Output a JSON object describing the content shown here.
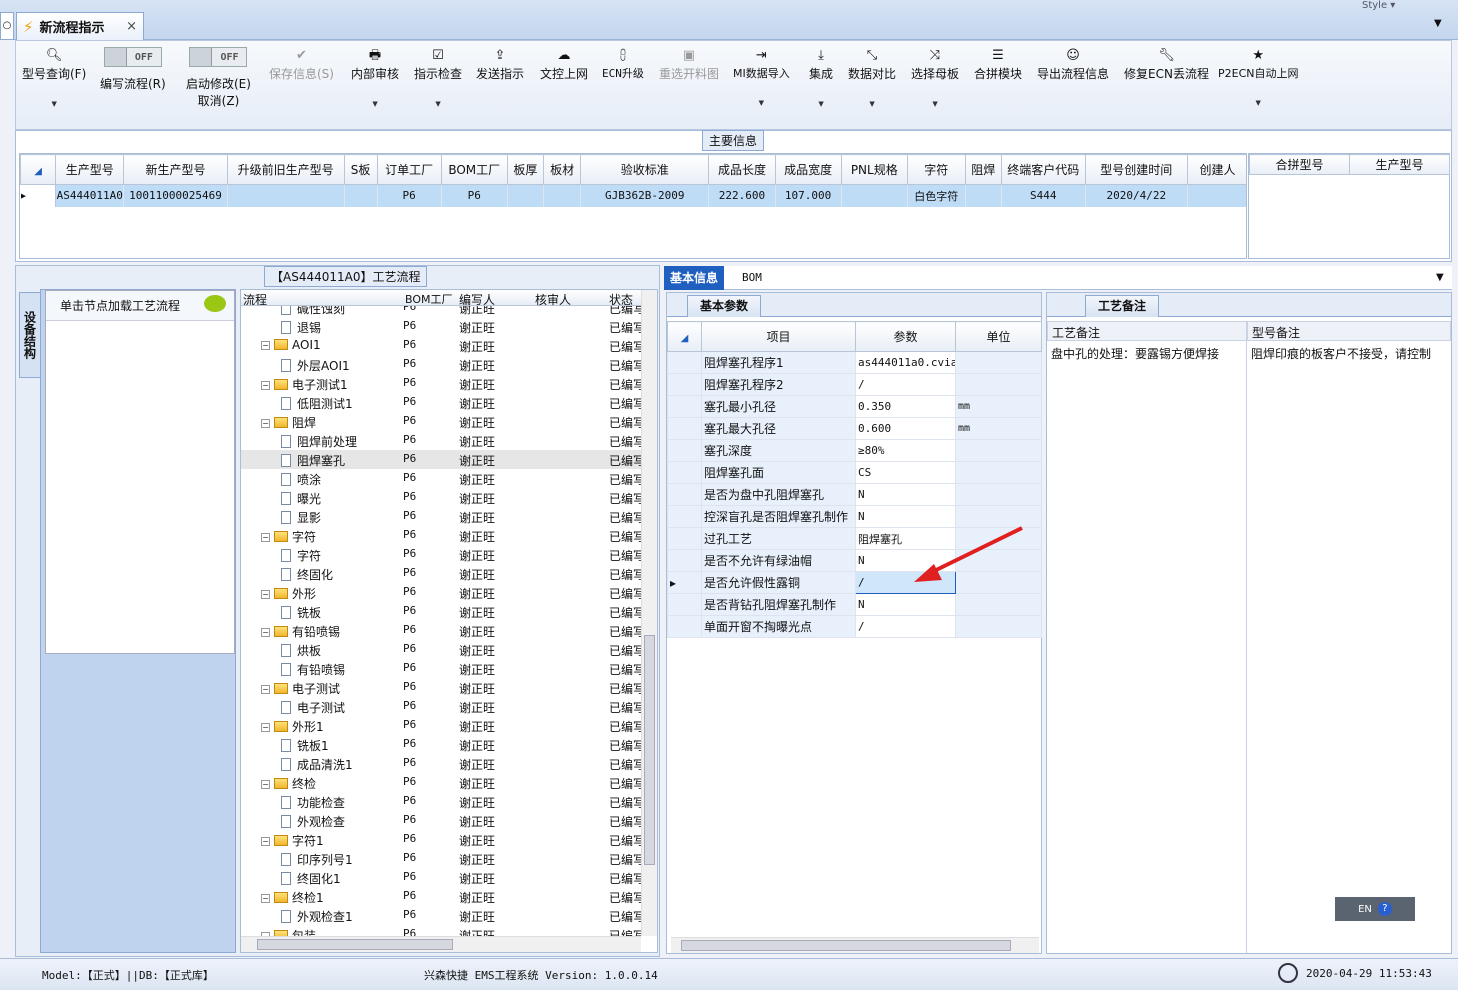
{
  "window": {
    "style_label": "Style"
  },
  "tab": {
    "title": "新流程指示",
    "close": "×"
  },
  "ribbon": {
    "search": "型号查询(F)",
    "edit_flow": "编写流程(R)",
    "enable_edit": "启动修改(E)",
    "cancel": "取消(Z)",
    "toggle1": "OFF",
    "toggle2": "OFF",
    "save": "保存信息(S)",
    "internal_review": "内部审核",
    "indicator_check": "指示检查",
    "send": "发送指示",
    "doc_upload": "文控上网",
    "ecn_upgrade": "ECN升级",
    "reselect_map": "重选开料图",
    "mi_import": "MI数据导入",
    "integrate": "集成",
    "compare": "数据对比",
    "select_master": "选择母板",
    "combine_module": "合拼模块",
    "export_flow": "导出流程信息",
    "fix_ecn": "修复ECN丢流程",
    "p2ecn": "P2ECN自动上网"
  },
  "main_info": {
    "title": "主要信息",
    "headers": [
      "生产型号",
      "新生产型号",
      "升级前旧生产型号",
      "S板",
      "订单工厂",
      "BOM工厂",
      "板厚",
      "板材",
      "验收标准",
      "成品长度",
      "成品宽度",
      "PNL规格",
      "字符",
      "阻焊",
      "终端客户代码",
      "型号创建时间",
      "创建人"
    ],
    "row": [
      "AS444011A0",
      "10011000025469",
      "",
      "",
      "P6",
      "P6",
      "",
      "",
      "GJB362B-2009",
      "222.600",
      "107.000",
      "",
      "白色字符",
      "",
      "S444",
      "2020/4/22",
      ""
    ],
    "side_headers": [
      "合拼型号",
      "生产型号"
    ]
  },
  "left": {
    "vtab": "设备结构",
    "hint": "单击节点加载工艺流程"
  },
  "tree": {
    "title": "【AS444011A0】工艺流程",
    "headers": [
      "流程",
      "BOM工厂",
      "编写人",
      "核审人",
      "状态"
    ],
    "rows": [
      {
        "t": "碱性蚀刻",
        "lvl": 2,
        "f": "P6",
        "w": "谢正旺",
        "s": "已编写"
      },
      {
        "t": "退锡",
        "lvl": 2,
        "f": "P6",
        "w": "谢正旺",
        "s": "已编写"
      },
      {
        "t": "AOI1",
        "lvl": 1,
        "f": "P6",
        "w": "谢正旺",
        "s": "已编写"
      },
      {
        "t": "外层AOI1",
        "lvl": 2,
        "f": "P6",
        "w": "谢正旺",
        "s": "已编写"
      },
      {
        "t": "电子测试1",
        "lvl": 1,
        "f": "P6",
        "w": "谢正旺",
        "s": "已编写"
      },
      {
        "t": "低阻测试1",
        "lvl": 2,
        "f": "P6",
        "w": "谢正旺",
        "s": "已编写"
      },
      {
        "t": "阻焊",
        "lvl": 1,
        "f": "P6",
        "w": "谢正旺",
        "s": "已编写"
      },
      {
        "t": "阻焊前处理",
        "lvl": 2,
        "f": "P6",
        "w": "谢正旺",
        "s": "已编写"
      },
      {
        "t": "阻焊塞孔",
        "lvl": 2,
        "f": "P6",
        "w": "谢正旺",
        "s": "已编写"
      },
      {
        "t": "喷涂",
        "lvl": 2,
        "f": "P6",
        "w": "谢正旺",
        "s": "已编写"
      },
      {
        "t": "曝光",
        "lvl": 2,
        "f": "P6",
        "w": "谢正旺",
        "s": "已编写"
      },
      {
        "t": "显影",
        "lvl": 2,
        "f": "P6",
        "w": "谢正旺",
        "s": "已编写"
      },
      {
        "t": "字符",
        "lvl": 1,
        "f": "P6",
        "w": "谢正旺",
        "s": "已编写"
      },
      {
        "t": "字符",
        "lvl": 2,
        "f": "P6",
        "w": "谢正旺",
        "s": "已编写"
      },
      {
        "t": "终固化",
        "lvl": 2,
        "f": "P6",
        "w": "谢正旺",
        "s": "已编写"
      },
      {
        "t": "外形",
        "lvl": 1,
        "f": "P6",
        "w": "谢正旺",
        "s": "已编写"
      },
      {
        "t": "铣板",
        "lvl": 2,
        "f": "P6",
        "w": "谢正旺",
        "s": "已编写"
      },
      {
        "t": "有铅喷锡",
        "lvl": 1,
        "f": "P6",
        "w": "谢正旺",
        "s": "已编写"
      },
      {
        "t": "烘板",
        "lvl": 2,
        "f": "P6",
        "w": "谢正旺",
        "s": "已编写"
      },
      {
        "t": "有铅喷锡",
        "lvl": 2,
        "f": "P6",
        "w": "谢正旺",
        "s": "已编写"
      },
      {
        "t": "电子测试",
        "lvl": 1,
        "f": "P6",
        "w": "谢正旺",
        "s": "已编写"
      },
      {
        "t": "电子测试",
        "lvl": 2,
        "f": "P6",
        "w": "谢正旺",
        "s": "已编写"
      },
      {
        "t": "外形1",
        "lvl": 1,
        "f": "P6",
        "w": "谢正旺",
        "s": "已编写"
      },
      {
        "t": "铣板1",
        "lvl": 2,
        "f": "P6",
        "w": "谢正旺",
        "s": "已编写"
      },
      {
        "t": "成品清洗1",
        "lvl": 2,
        "f": "P6",
        "w": "谢正旺",
        "s": "已编写"
      },
      {
        "t": "终检",
        "lvl": 1,
        "f": "P6",
        "w": "谢正旺",
        "s": "已编写"
      },
      {
        "t": "功能检查",
        "lvl": 2,
        "f": "P6",
        "w": "谢正旺",
        "s": "已编写"
      },
      {
        "t": "外观检查",
        "lvl": 2,
        "f": "P6",
        "w": "谢正旺",
        "s": "已编写"
      },
      {
        "t": "字符1",
        "lvl": 1,
        "f": "P6",
        "w": "谢正旺",
        "s": "已编写"
      },
      {
        "t": "印序列号1",
        "lvl": 2,
        "f": "P6",
        "w": "谢正旺",
        "s": "已编写"
      },
      {
        "t": "终固化1",
        "lvl": 2,
        "f": "P6",
        "w": "谢正旺",
        "s": "已编写"
      },
      {
        "t": "终检1",
        "lvl": 1,
        "f": "P6",
        "w": "谢正旺",
        "s": "已编写"
      },
      {
        "t": "外观检查1",
        "lvl": 2,
        "f": "P6",
        "w": "谢正旺",
        "s": "已编写"
      },
      {
        "t": "包装",
        "lvl": 1,
        "f": "P6",
        "w": "谢正旺",
        "s": "已编写"
      }
    ]
  },
  "right_tabs": {
    "basic": "基本信息",
    "bom": "BOM"
  },
  "params": {
    "tab": "基本参数",
    "headers": [
      "项目",
      "参数",
      "单位"
    ],
    "rows": [
      [
        "阻焊塞孔程序1",
        "as444011a0.cvia",
        ""
      ],
      [
        "阻焊塞孔程序2",
        "/",
        ""
      ],
      [
        "塞孔最小孔径",
        "0.350",
        "mm"
      ],
      [
        "塞孔最大孔径",
        "0.600",
        "mm"
      ],
      [
        "塞孔深度",
        "≥80%",
        ""
      ],
      [
        "阻焊塞孔面",
        "CS",
        ""
      ],
      [
        "是否为盘中孔阻焊塞孔",
        "N",
        ""
      ],
      [
        "控深盲孔是否阻焊塞孔制作",
        "N",
        ""
      ],
      [
        "过孔工艺",
        "阻焊塞孔",
        ""
      ],
      [
        "是否不允许有绿油帽",
        "N",
        ""
      ],
      [
        "是否允许假性露铜",
        "/",
        ""
      ],
      [
        "是否背钻孔阻焊塞孔制作",
        "N",
        ""
      ],
      [
        "单面开窗不掏曝光点",
        "/",
        ""
      ]
    ]
  },
  "notes": {
    "tab": "工艺备注",
    "col1": "工艺备注",
    "col2": "型号备注",
    "text1": "盘中孔的处理：要露锡方便焊接",
    "text2": "阻焊印痕的板客户不接受，请控制",
    "ime": "EN"
  },
  "status": {
    "model": "Model:【正式】||DB:【正式库】",
    "app": "兴森快捷 EMS工程系统 Version: 1.0.0.14",
    "datetime": "2020-04-29 11:53:43"
  },
  "colors": {
    "accent": "#1f5fbf",
    "selection": "#bfdcf7",
    "arrow": "#e02020"
  }
}
